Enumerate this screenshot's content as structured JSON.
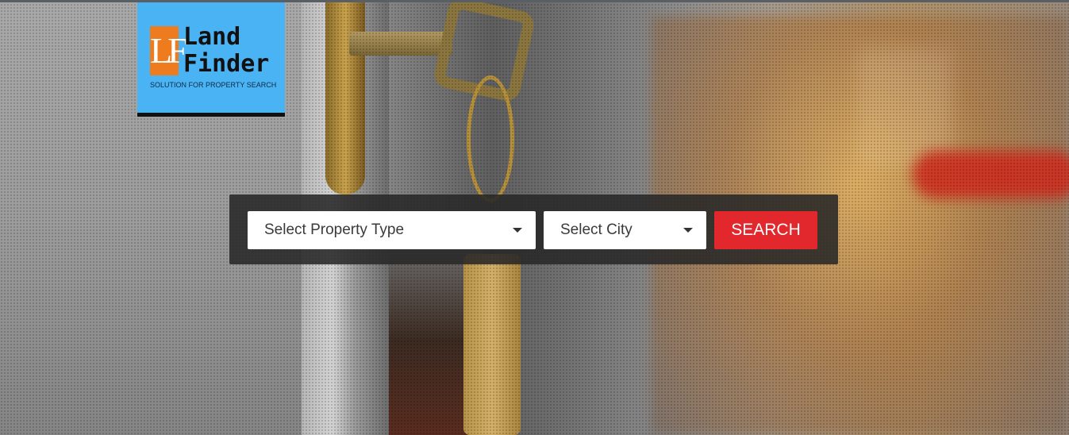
{
  "logo": {
    "mark": "LF",
    "line1": "Land",
    "line2": "Finder",
    "tagline": "SOLUTION FOR PROPERTY SEARCH",
    "background_color": "#4ab3f4",
    "mark_color": "#ef7b1f"
  },
  "search": {
    "property_type_label": "Select Property Type",
    "city_label": "Select City",
    "button_label": "SEARCH",
    "button_color": "#e2272d"
  }
}
